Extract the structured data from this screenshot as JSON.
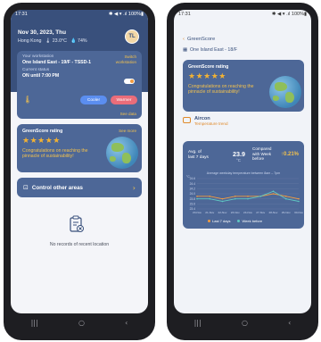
{
  "left": {
    "status": {
      "time": "17:31",
      "icons": "✱ ◀ ▾ .ıl 100%▮"
    },
    "header": {
      "date": "Nov 30, 2023, Thu",
      "city": "Hong Kong",
      "temp": "🌡 23.0°C",
      "humidity": "💧 74%",
      "avatar": "TL"
    },
    "workstation": {
      "label": "Your workstation",
      "value": "One Island East - 19/F - TSSD-1",
      "switch": "Switch workstation",
      "status_label": "Current status",
      "status_value": "ON until 7:00 PM",
      "cooler": "Cooler",
      "warmer": "Warmer",
      "see_data": "See data"
    },
    "greenscore": {
      "title": "GreenScore rating",
      "see_more": "See more",
      "stars": "★★★★★",
      "message": "Congratulations on reaching the pinnacle of sustainability!"
    },
    "control": {
      "label": "Control other areas",
      "arrow": "›"
    },
    "empty": {
      "text": "No records of recent location"
    }
  },
  "right": {
    "status": {
      "time": "17:31",
      "icons": "✱ ◀ ▾ .ıl 100%▮"
    },
    "back_label": "GreenScore",
    "location": "One Island East - 18/F",
    "greenscore": {
      "title": "GreenScore rating",
      "stars": "★★★★★",
      "message": "Congratulations on reaching the pinnacle of sustainability!"
    },
    "aircon": {
      "title": "Aircon",
      "subtitle": "Temperature trend",
      "avg_label": "Avg. of last 7 days",
      "avg_value": "23.9",
      "avg_unit": "°C",
      "compare": "Compared with Week before",
      "change": "↑0.21%",
      "chart_title": "Average weekday temperature between 8am – 7pm",
      "legend_this": "Last 7 days",
      "legend_prev": "Week before"
    }
  },
  "nav": {
    "recent": "|||",
    "home": "○",
    "back": "‹"
  },
  "colors": {
    "primary": "#39507c",
    "card": "#4d6797",
    "accent": "#f2c14e",
    "cool": "#5b8ef0",
    "warm": "#ea6d7a",
    "trend_prev": "#5fc7c2"
  },
  "chart_data": {
    "type": "line",
    "title": "Average weekday temperature between 8am – 7pm",
    "ylabel": "°C",
    "yticks": [
      "24.6",
      "24.4",
      "24.2",
      "24.0",
      "23.8",
      "23.6",
      "23.4"
    ],
    "ylim": [
      23.4,
      24.6
    ],
    "x": [
      "20-Nov",
      "21-Nov",
      "22-Nov",
      "23-Nov",
      "24-Nov",
      "27-Nov",
      "28-Nov",
      "29-Nov",
      "30-Nov"
    ],
    "series": [
      {
        "name": "Last 7 days",
        "color": "#f29b3f",
        "values": [
          23.9,
          23.9,
          23.8,
          23.9,
          23.9,
          23.9,
          24.0,
          23.9,
          23.8
        ]
      },
      {
        "name": "Week before",
        "color": "#5fc7c2",
        "values": [
          23.8,
          23.8,
          23.7,
          23.8,
          23.8,
          23.9,
          24.1,
          23.8,
          23.7
        ]
      }
    ],
    "grid": true,
    "legend": "bottom"
  }
}
